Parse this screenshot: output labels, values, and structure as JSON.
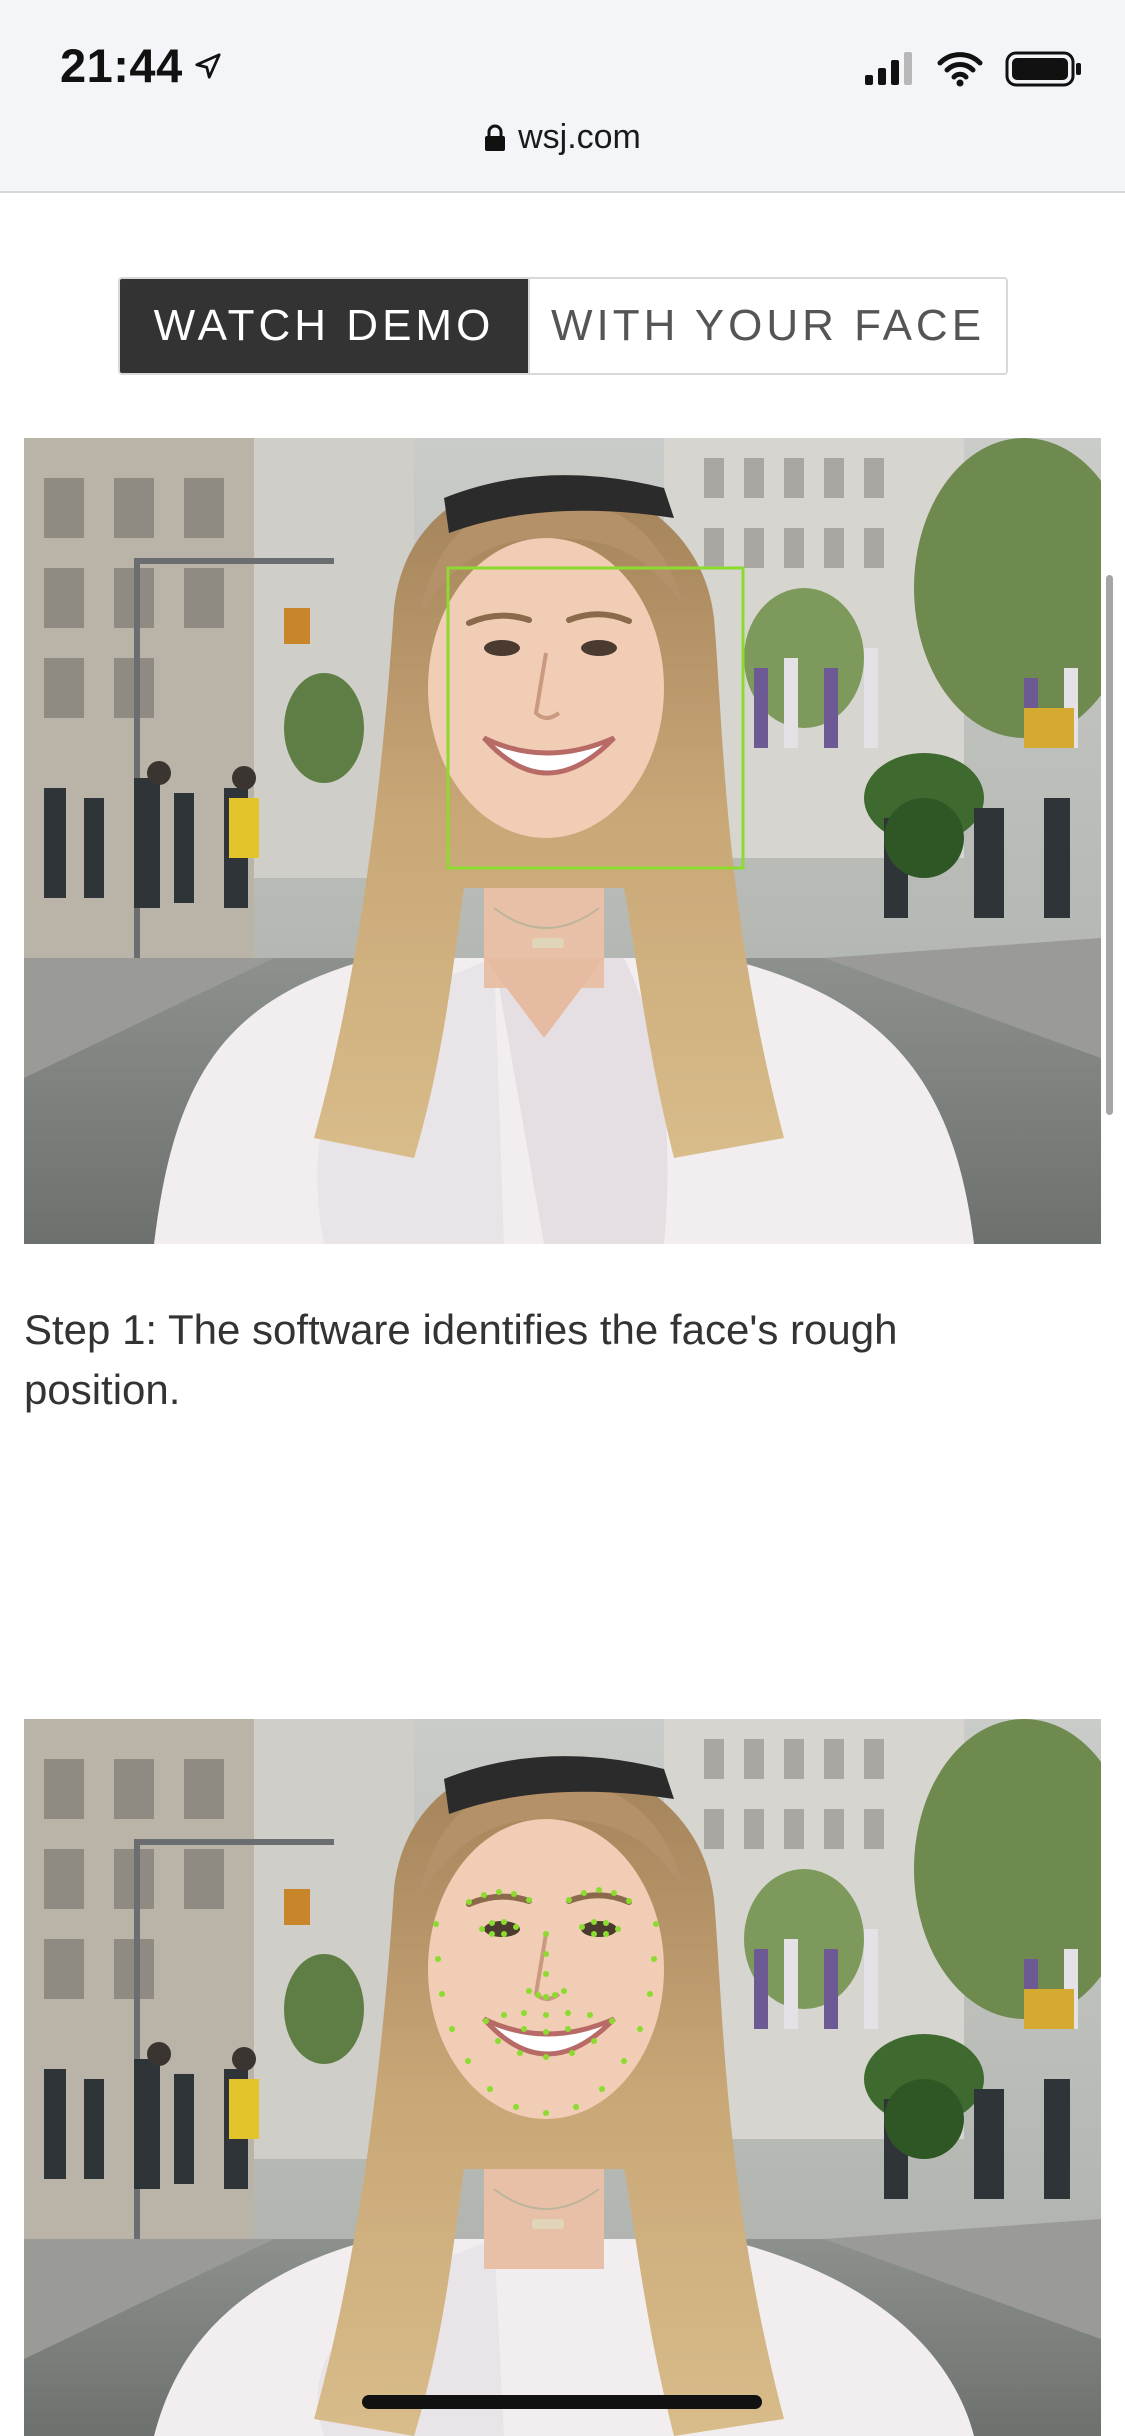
{
  "status_bar": {
    "time": "21:44",
    "location_icon": "location-arrow-icon",
    "signal_icon": "cellular-signal-icon",
    "wifi_icon": "wifi-icon",
    "battery_icon": "battery-icon"
  },
  "browser": {
    "lock_icon": "lock-icon",
    "url": "wsj.com"
  },
  "demo_toggle": {
    "watch_demo_label": "WATCH DEMO",
    "your_face_label": "WITH YOUR FACE",
    "selected": "WATCH DEMO"
  },
  "steps": [
    {
      "image_alt": "Woman smiling on a city street with a green bounding box around her face",
      "caption": "Step 1: The software identifies the face's rough position."
    },
    {
      "image_alt": "Same woman with green facial landmark points on eyes, nose, mouth and jawline"
    }
  ],
  "colors": {
    "overlay_green": "#8bdc2e",
    "toggle_active_bg": "#333333",
    "caption_text": "#333333"
  }
}
